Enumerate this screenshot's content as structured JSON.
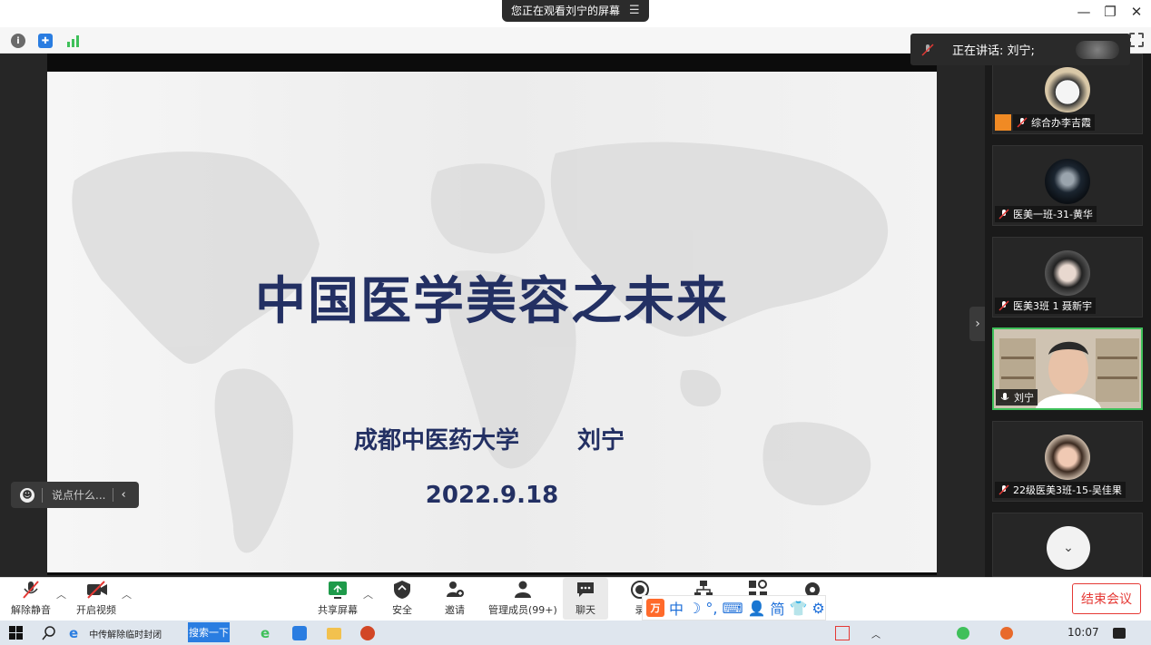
{
  "top": {
    "share_status": "您正在观看刘宁的屏幕",
    "minimize": "—",
    "restore": "❐",
    "close": "✕"
  },
  "speaking": {
    "label": "正在讲话: 刘宁;"
  },
  "slide": {
    "title": "中国医学美容之未来",
    "university": "成都中医药大学",
    "author": "刘宁",
    "date": "2022.9.18"
  },
  "chat_input": {
    "placeholder": "说点什么..."
  },
  "participants": [
    {
      "name": "综合办李吉霞",
      "muted": true,
      "host": true
    },
    {
      "name": "医美一班-31-黄华",
      "muted": true
    },
    {
      "name": "医美3班 1 聂新宇",
      "muted": true
    },
    {
      "name": "刘宁",
      "muted": false,
      "active": true
    },
    {
      "name": "22级医美3班-15-吴佳果",
      "muted": true
    }
  ],
  "toolbar": {
    "unmute": "解除静音",
    "start_video": "开启视频",
    "share_screen": "共享屏幕",
    "security": "安全",
    "invite": "邀请",
    "manage_members": "管理成员(99+)",
    "chat": "聊天",
    "record": "录",
    "end_meeting": "结束会议"
  },
  "ime": {
    "logo": "万",
    "items": [
      "中",
      "☽",
      "°,",
      "⌨",
      "👤",
      "简",
      "👕",
      "⚙"
    ]
  },
  "taskbar": {
    "browser_tab": "中传解除临时封闭",
    "search_button": "搜索一下",
    "clock": "10:07"
  },
  "colors": {
    "slide_text": "#233063",
    "active_border": "#3fc05a",
    "end_red": "#e53935",
    "taskbar_blue": "#2a7de1"
  }
}
